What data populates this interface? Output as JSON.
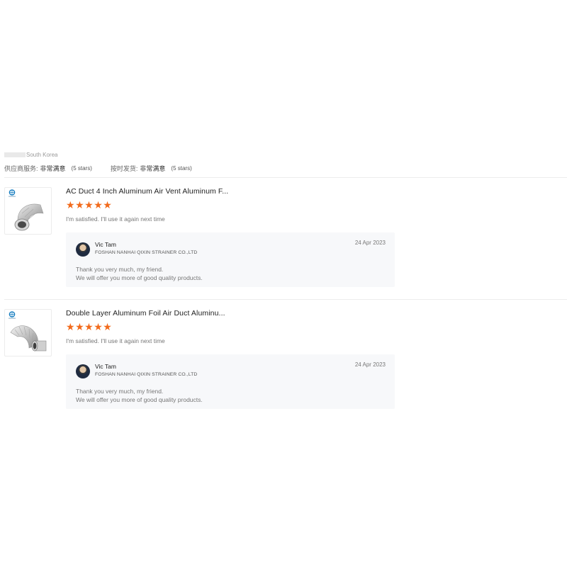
{
  "buyer": {
    "country": "South Korea",
    "ratings": [
      {
        "label": "供应商服务:",
        "value": "非常满意",
        "stars": "(5 stars)"
      },
      {
        "label": "按时发货:",
        "value": "非常满意",
        "stars": "(5 stars)"
      }
    ]
  },
  "reviews": [
    {
      "product_title": "AC Duct 4 Inch Aluminum Air Vent Aluminum F...",
      "rating": 5,
      "star_glyph": "★",
      "comment": "I'm satisfied. I'll use it again next time",
      "thumbnail_icon": "aluminum-duct-image",
      "reply": {
        "name": "Vic Tam",
        "company": "FOSHAN NANHAI QIXIN STRAINER CO.,LTD",
        "date": "24 Apr 2023",
        "lines": [
          "Thank you very much, my friend.",
          "We will offer you more of good quality products."
        ]
      }
    },
    {
      "product_title": "Double Layer Aluminum Foil Air Duct Aluminu...",
      "rating": 5,
      "star_glyph": "★",
      "comment": "I'm satisfied. I'll use it again next time",
      "thumbnail_icon": "foil-duct-image",
      "reply": {
        "name": "Vic Tam",
        "company": "FOSHAN NANHAI QIXIN STRAINER CO.,LTD",
        "date": "24 Apr 2023",
        "lines": [
          "Thank you very much, my friend.",
          "We will offer you more of good quality products."
        ]
      }
    }
  ],
  "colors": {
    "star": "#f26a1b",
    "reply_bg": "#f7f8fa",
    "logo": "#1a7fc1"
  }
}
